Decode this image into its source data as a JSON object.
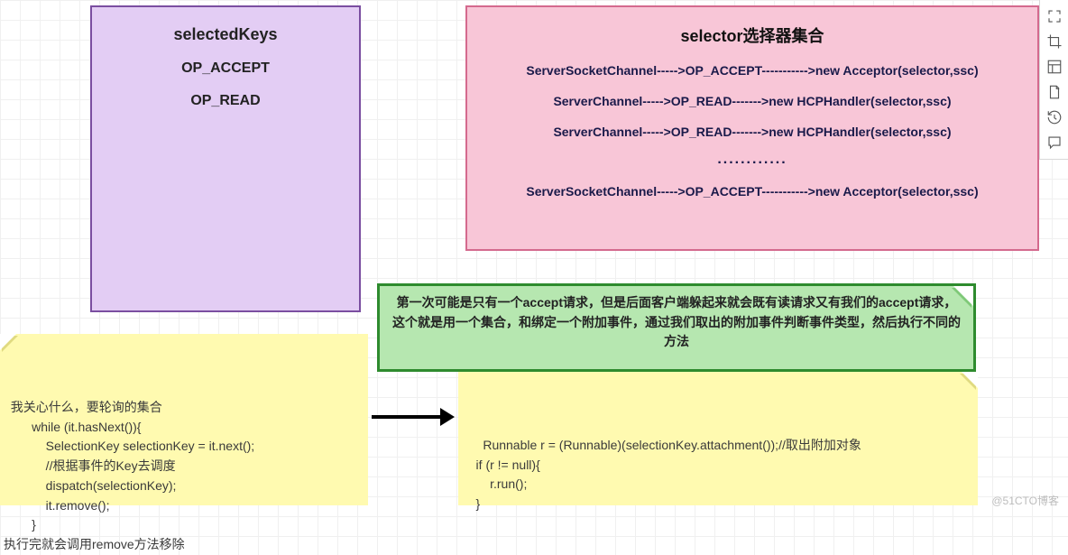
{
  "purple": {
    "title": "selectedKeys",
    "line1": "OP_ACCEPT",
    "line2": "OP_READ"
  },
  "pink": {
    "title": "selector选择器集合",
    "flow1": "ServerSocketChannel----->OP_ACCEPT----------->new Acceptor(selector,ssc)",
    "flow2": "ServerChannel----->OP_READ------->new  HCPHandler(selector,ssc)",
    "flow3": "ServerChannel----->OP_READ------->new  HCPHandler(selector,ssc)",
    "dots": "............",
    "flow4": "ServerSocketChannel----->OP_ACCEPT----------->new Acceptor(selector,ssc)"
  },
  "green": {
    "line1": "第一次可能是只有一个accept请求，但是后面客户端躲起来就会既有读请求又有我们的accept请求，",
    "line2": "这个就是用一个集合，和绑定一个附加事件，通过我们取出的附加事件判断事件类型，然后执行不同的方法"
  },
  "yellow_left": {
    "text": "我关心什么，要轮询的集合\n        while (it.hasNext()){\n            SelectionKey selectionKey = it.next();\n            //根据事件的Key去调度\n            dispatch(selectionKey);\n            it.remove();\n        }\n执行完就会调用remove方法移除"
  },
  "yellow_right": {
    "text": "    Runnable r = (Runnable)(selectionKey.attachment());//取出附加对象\n    if (r != null){\n        r.run();\n    }"
  },
  "toolbar": {
    "items": [
      {
        "name": "expand-corners-icon"
      },
      {
        "name": "crop-icon"
      },
      {
        "name": "layout-icon"
      },
      {
        "name": "page-icon"
      },
      {
        "name": "history-icon"
      },
      {
        "name": "comment-icon"
      }
    ]
  },
  "watermark": "@51CTO博客"
}
